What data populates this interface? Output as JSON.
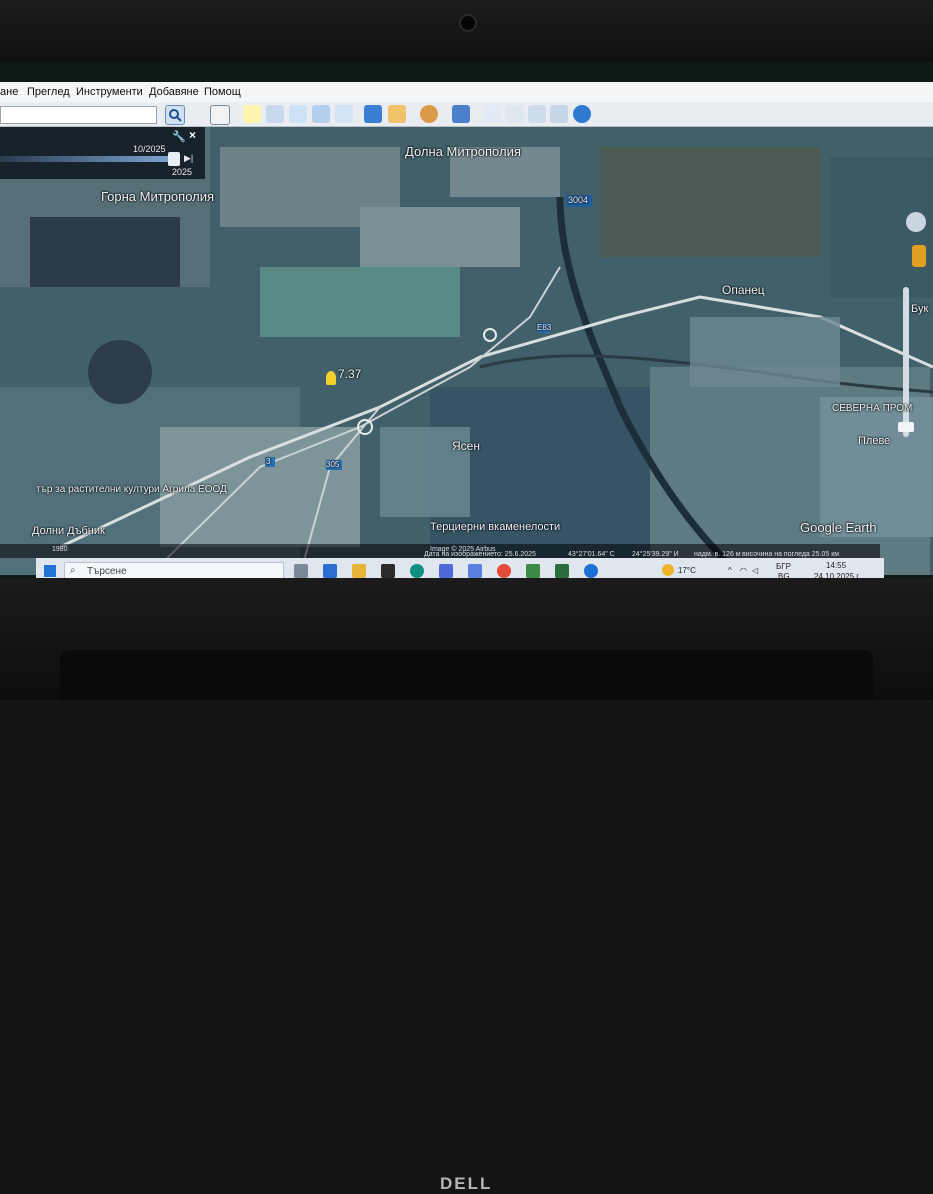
{
  "menu": {
    "file_partial": "ане",
    "view": "Преглед",
    "tools": "Инструменти",
    "add": "Добавяне",
    "help": "Помощ"
  },
  "timeslider": {
    "date": "10/2025",
    "year_end": "2025"
  },
  "map_labels": {
    "dolna_mitropolia": "Долна Митрополия",
    "gorna_mitropolia": "Горна Митрополия",
    "road_3004": "3004",
    "opanets": "Опанец",
    "buk_partial": "Бук",
    "severna_prom": "СЕВЕРНА ПРОМ",
    "pleven_partial": "Плеве",
    "yasen": "Ясен",
    "placemark": "7.37",
    "agro_partial": "тър за растителни култури Агрила ЕООД",
    "dolni_dabnik": "Долни Дъбник",
    "tertsierni": "Терциерни вкаменелости",
    "road_3": "3",
    "road_305": "305",
    "road_e83": "E83",
    "google_earth": "Google Earth"
  },
  "status": {
    "copyright": "Image © 2025 Airbus",
    "imagery_date": "Дата на изображението: 25.6.2025",
    "lat": "43°27'01.64\" С",
    "lon": "24°25'39.29\" И",
    "elevation": "надм. в. 126 м",
    "eye_alt": "височина на погледа 25.05 км",
    "scale_km": "1980"
  },
  "taskbar": {
    "search_placeholder": "Търсене",
    "temperature": "17°C",
    "lang": "БГР",
    "lang2": "BG",
    "time": "14:55",
    "date": "24.10.2025 г."
  },
  "device": {
    "brand": "DELL"
  }
}
